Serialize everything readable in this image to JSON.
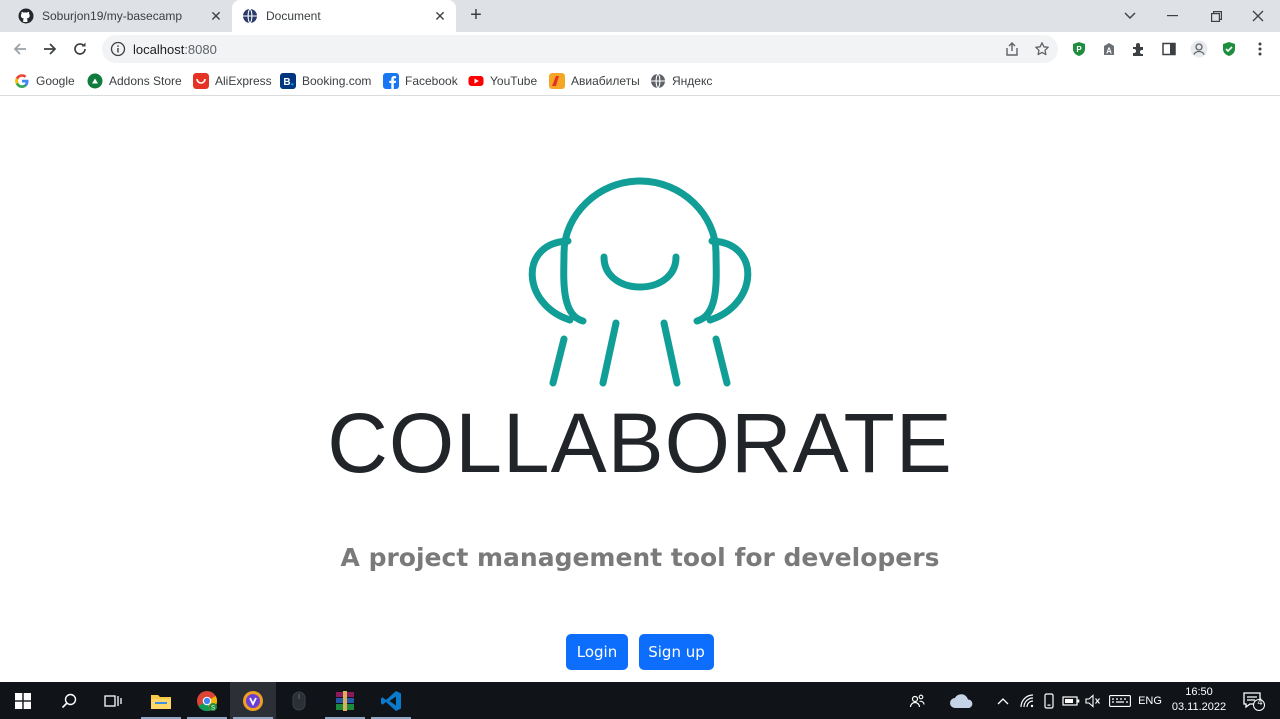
{
  "browser": {
    "tabs": [
      {
        "title": "Soburjon19/my-basecamp",
        "icon": "github-icon",
        "active": false
      },
      {
        "title": "Document",
        "icon": "globe-icon",
        "active": true
      }
    ],
    "address": {
      "host": "localhost",
      "port": ":8080"
    },
    "bookmarks": [
      {
        "label": "Google",
        "icon": "google-icon",
        "color": "#4285f4"
      },
      {
        "label": "Addons Store",
        "icon": "addons-store-icon",
        "color": "#0f7b3c"
      },
      {
        "label": "AliExpress",
        "icon": "aliexpress-icon",
        "color": "#e43225"
      },
      {
        "label": "Booking.com",
        "icon": "booking-icon",
        "color": "#003580"
      },
      {
        "label": "Facebook",
        "icon": "facebook-icon",
        "color": "#1877f2"
      },
      {
        "label": "YouTube",
        "icon": "youtube-icon",
        "color": "#ff0000"
      },
      {
        "label": "Авиабилеты",
        "icon": "aviasales-icon",
        "color": "#f5a623"
      },
      {
        "label": "Яндекс",
        "icon": "globe-icon",
        "color": "#5f6368"
      }
    ]
  },
  "page": {
    "brand": "COLLABORATE",
    "tagline": "A project management tool for developers",
    "login_label": "Login",
    "signup_label": "Sign up",
    "accent_color": "#119e97",
    "button_color": "#0d6efd"
  },
  "taskbar": {
    "language": "ENG",
    "time": "16:50",
    "date": "03.11.2022",
    "notifications": "4"
  }
}
